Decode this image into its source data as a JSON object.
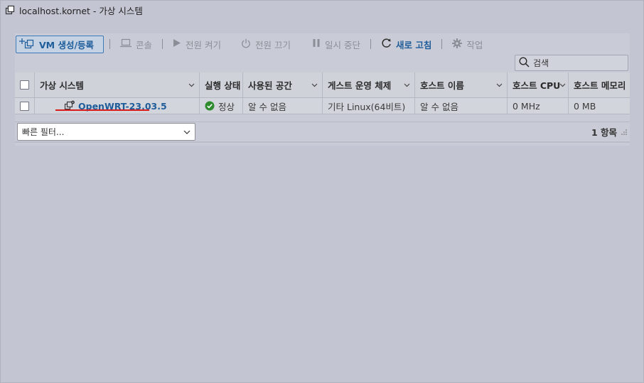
{
  "window": {
    "title": "localhost.kornet - 가상 시스템"
  },
  "toolbar": {
    "create_label": "VM 생성/등록",
    "console_label": "콘솔",
    "power_on_label": "전원 켜기",
    "power_off_label": "전원 끄기",
    "suspend_label": "일시 중단",
    "refresh_label": "새로 고침",
    "actions_label": "작업"
  },
  "search": {
    "placeholder": "검색"
  },
  "table": {
    "columns": [
      "가상 시스템",
      "실행 상태",
      "사용된 공간",
      "게스트 운영 체제",
      "호스트 이름",
      "호스트 CPU",
      "호스트 메모리"
    ],
    "rows": [
      {
        "name": "OpenWRT-23.03.5",
        "status": "정상",
        "used_space": "알 수 없음",
        "guest_os": "기타 Linux(64비트)",
        "host_name": "알 수 없음",
        "host_cpu": "0 MHz",
        "host_memory": "0 MB"
      }
    ]
  },
  "footer": {
    "quick_filter": "빠른 필터...",
    "item_count": "1 항목"
  },
  "colors": {
    "accent": "#1f5d9a",
    "status_ok": "#2e8b2e",
    "highlight": "#d91b1b"
  }
}
